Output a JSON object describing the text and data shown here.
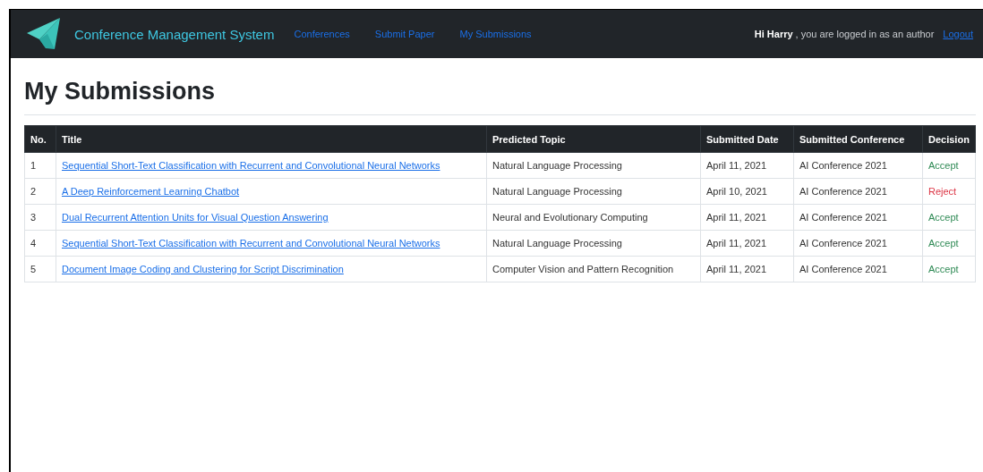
{
  "navbar": {
    "brand": "Conference Management System",
    "links": [
      {
        "label": "Conferences",
        "selected": false
      },
      {
        "label": "Submit Paper",
        "selected": false
      },
      {
        "label": "My Submissions",
        "selected": false
      }
    ],
    "greeting": "**Hi Harry** , you are logged in as an author",
    "logout": "Logout"
  },
  "heading": "My Submissions",
  "table": {
    "columns": [
      "No.",
      "Title",
      "Predicted Topic",
      "Submitted Date",
      "Submitted Conference",
      "Decision"
    ],
    "rows": [
      {
        "no": "1",
        "title": "Sequential Short-Text Classification with Recurrent and Convolutional Neural Networks",
        "topic": "Natural Language Processing",
        "date": "April 11, 2021",
        "conference": "AI Conference 2021",
        "decision": "Accept",
        "color": "#2f8a55"
      },
      {
        "no": "2",
        "title": "A Deep Reinforcement Learning Chatbot",
        "topic": "Natural Language Processing",
        "date": "April 10, 2021",
        "conference": "AI Conference 2021",
        "decision": "Reject",
        "color": "#dc3545"
      },
      {
        "no": "3",
        "title": "Dual Recurrent Attention Units for Visual Question Answering",
        "topic": "Neural and Evolutionary Computing",
        "date": "April 11, 2021",
        "conference": "AI Conference 2021",
        "decision": "Accept",
        "color": "#2f8a55"
      },
      {
        "no": "4",
        "title": "Sequential Short-Text Classification with Recurrent and Convolutional Neural Networks",
        "topic": "Natural Language Processing",
        "date": "April 11, 2021",
        "conference": "AI Conference 2021",
        "decision": "Accept",
        "color": "#2f8a55"
      },
      {
        "no": "5",
        "title": "Document Image Coding and Clustering for Script Discrimination",
        "topic": "Computer Vision and Pattern Recognition",
        "date": "April 11, 2021",
        "conference": "AI Conference 2021",
        "decision": "Accept",
        "color": "#2f8a55"
      }
    ]
  }
}
